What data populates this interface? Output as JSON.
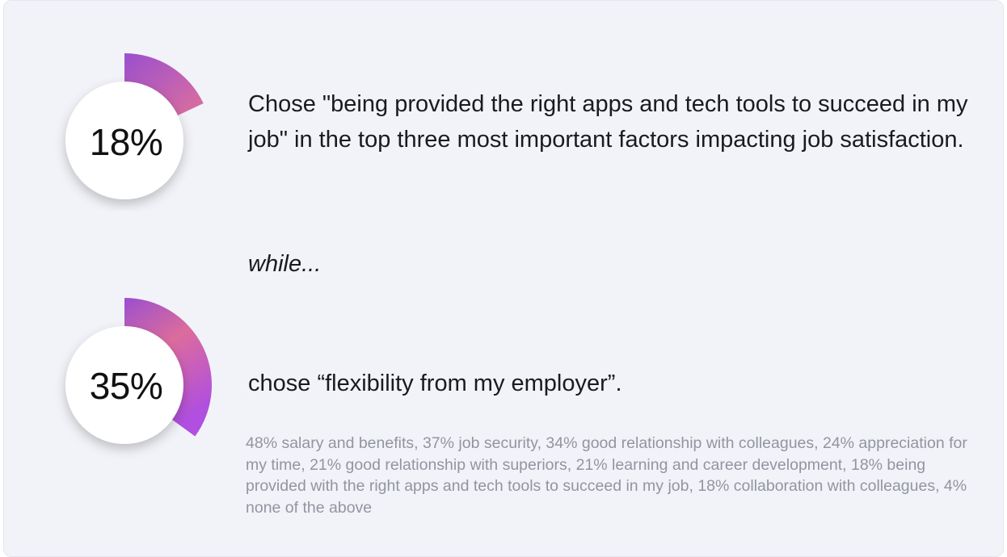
{
  "stats": [
    {
      "value_label": "18%",
      "value": 18,
      "text": "Chose \"being provided the right apps and tech tools to succeed in my job\" in the top three most important factors impacting job satisfaction."
    },
    {
      "value_label": "35%",
      "value": 35,
      "text": "chose “flexibility from my employer”."
    }
  ],
  "connector": "while...",
  "footnote": "48% salary and benefits, 37% job security, 34% good relationship with colleagues, 24% appreciation for my time, 21% good relationship with superiors, 21% learning and career development, 18% being provided with the right apps and tech tools to succeed in my job, 18% collaboration with colleagues, 4% none of the above",
  "colors": {
    "gradient_start": "#9a4fcf",
    "gradient_mid": "#dc6c9c",
    "gradient_end": "#b04fe0",
    "circle_fill": "#ffffff",
    "background": "#f2f3f8"
  },
  "chart_data": [
    {
      "type": "pie",
      "title": "",
      "values": [
        18
      ],
      "value_label": "18%"
    },
    {
      "type": "pie",
      "title": "",
      "values": [
        35
      ],
      "value_label": "35%"
    }
  ]
}
